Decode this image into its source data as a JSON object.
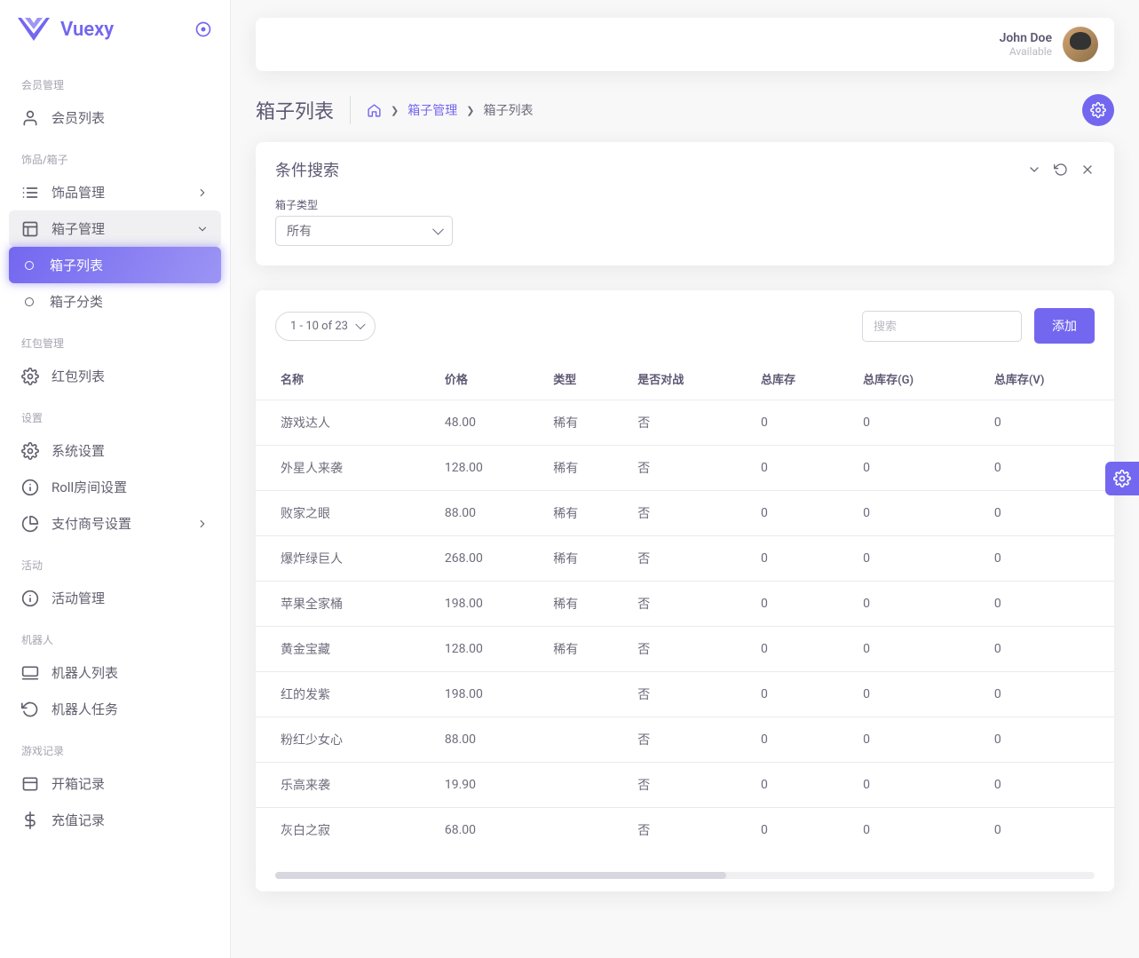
{
  "brand": {
    "name": "Vuexy"
  },
  "user": {
    "name": "John Doe",
    "status": "Available"
  },
  "sidebar": {
    "groups": [
      {
        "title": "会员管理",
        "items": [
          {
            "label": "会员列表",
            "icon": "user-icon"
          }
        ]
      },
      {
        "title": "饰品/箱子",
        "items": [
          {
            "label": "饰品管理",
            "icon": "list-icon",
            "hasChildren": true
          },
          {
            "label": "箱子管理",
            "icon": "layout-icon",
            "hasChildren": true,
            "open": true,
            "children": [
              {
                "label": "箱子列表",
                "active": true
              },
              {
                "label": "箱子分类"
              }
            ]
          }
        ]
      },
      {
        "title": "红包管理",
        "items": [
          {
            "label": "红包列表",
            "icon": "gear-icon"
          }
        ]
      },
      {
        "title": "设置",
        "items": [
          {
            "label": "系统设置",
            "icon": "gear-icon"
          },
          {
            "label": "Roll房间设置",
            "icon": "info-icon"
          },
          {
            "label": "支付商号设置",
            "icon": "pie-icon",
            "hasChildren": true
          }
        ]
      },
      {
        "title": "活动",
        "items": [
          {
            "label": "活动管理",
            "icon": "info-icon"
          }
        ]
      },
      {
        "title": "机器人",
        "items": [
          {
            "label": "机器人列表",
            "icon": "monitor-icon"
          },
          {
            "label": "机器人任务",
            "icon": "refresh-icon"
          }
        ]
      },
      {
        "title": "游戏记录",
        "items": [
          {
            "label": "开箱记录",
            "icon": "box-icon"
          },
          {
            "label": "充值记录",
            "icon": "dollar-icon"
          }
        ]
      }
    ]
  },
  "page": {
    "title": "箱子列表",
    "breadcrumb": {
      "link": "箱子管理",
      "current": "箱子列表"
    }
  },
  "filter": {
    "cardTitle": "条件搜索",
    "typeLabel": "箱子类型",
    "typeValue": "所有"
  },
  "table": {
    "pager": "1 - 10 of 23",
    "searchPlaceholder": "搜索",
    "addLabel": "添加",
    "columns": [
      "名称",
      "价格",
      "类型",
      "是否对战",
      "总库存",
      "总库存(G)",
      "总库存(V)"
    ],
    "rows": [
      {
        "c": [
          "游戏达人",
          "48.00",
          "稀有",
          "否",
          "0",
          "0",
          "0"
        ]
      },
      {
        "c": [
          "外星人来袭",
          "128.00",
          "稀有",
          "否",
          "0",
          "0",
          "0"
        ]
      },
      {
        "c": [
          "败家之眼",
          "88.00",
          "稀有",
          "否",
          "0",
          "0",
          "0"
        ]
      },
      {
        "c": [
          "爆炸绿巨人",
          "268.00",
          "稀有",
          "否",
          "0",
          "0",
          "0"
        ]
      },
      {
        "c": [
          "苹果全家桶",
          "198.00",
          "稀有",
          "否",
          "0",
          "0",
          "0"
        ]
      },
      {
        "c": [
          "黄金宝藏",
          "128.00",
          "稀有",
          "否",
          "0",
          "0",
          "0"
        ]
      },
      {
        "c": [
          "红的发紫",
          "198.00",
          "",
          "否",
          "0",
          "0",
          "0"
        ]
      },
      {
        "c": [
          "粉红少女心",
          "88.00",
          "",
          "否",
          "0",
          "0",
          "0"
        ]
      },
      {
        "c": [
          "乐高来袭",
          "19.90",
          "",
          "否",
          "0",
          "0",
          "0"
        ]
      },
      {
        "c": [
          "灰白之寂",
          "68.00",
          "",
          "否",
          "0",
          "0",
          "0"
        ]
      }
    ]
  }
}
